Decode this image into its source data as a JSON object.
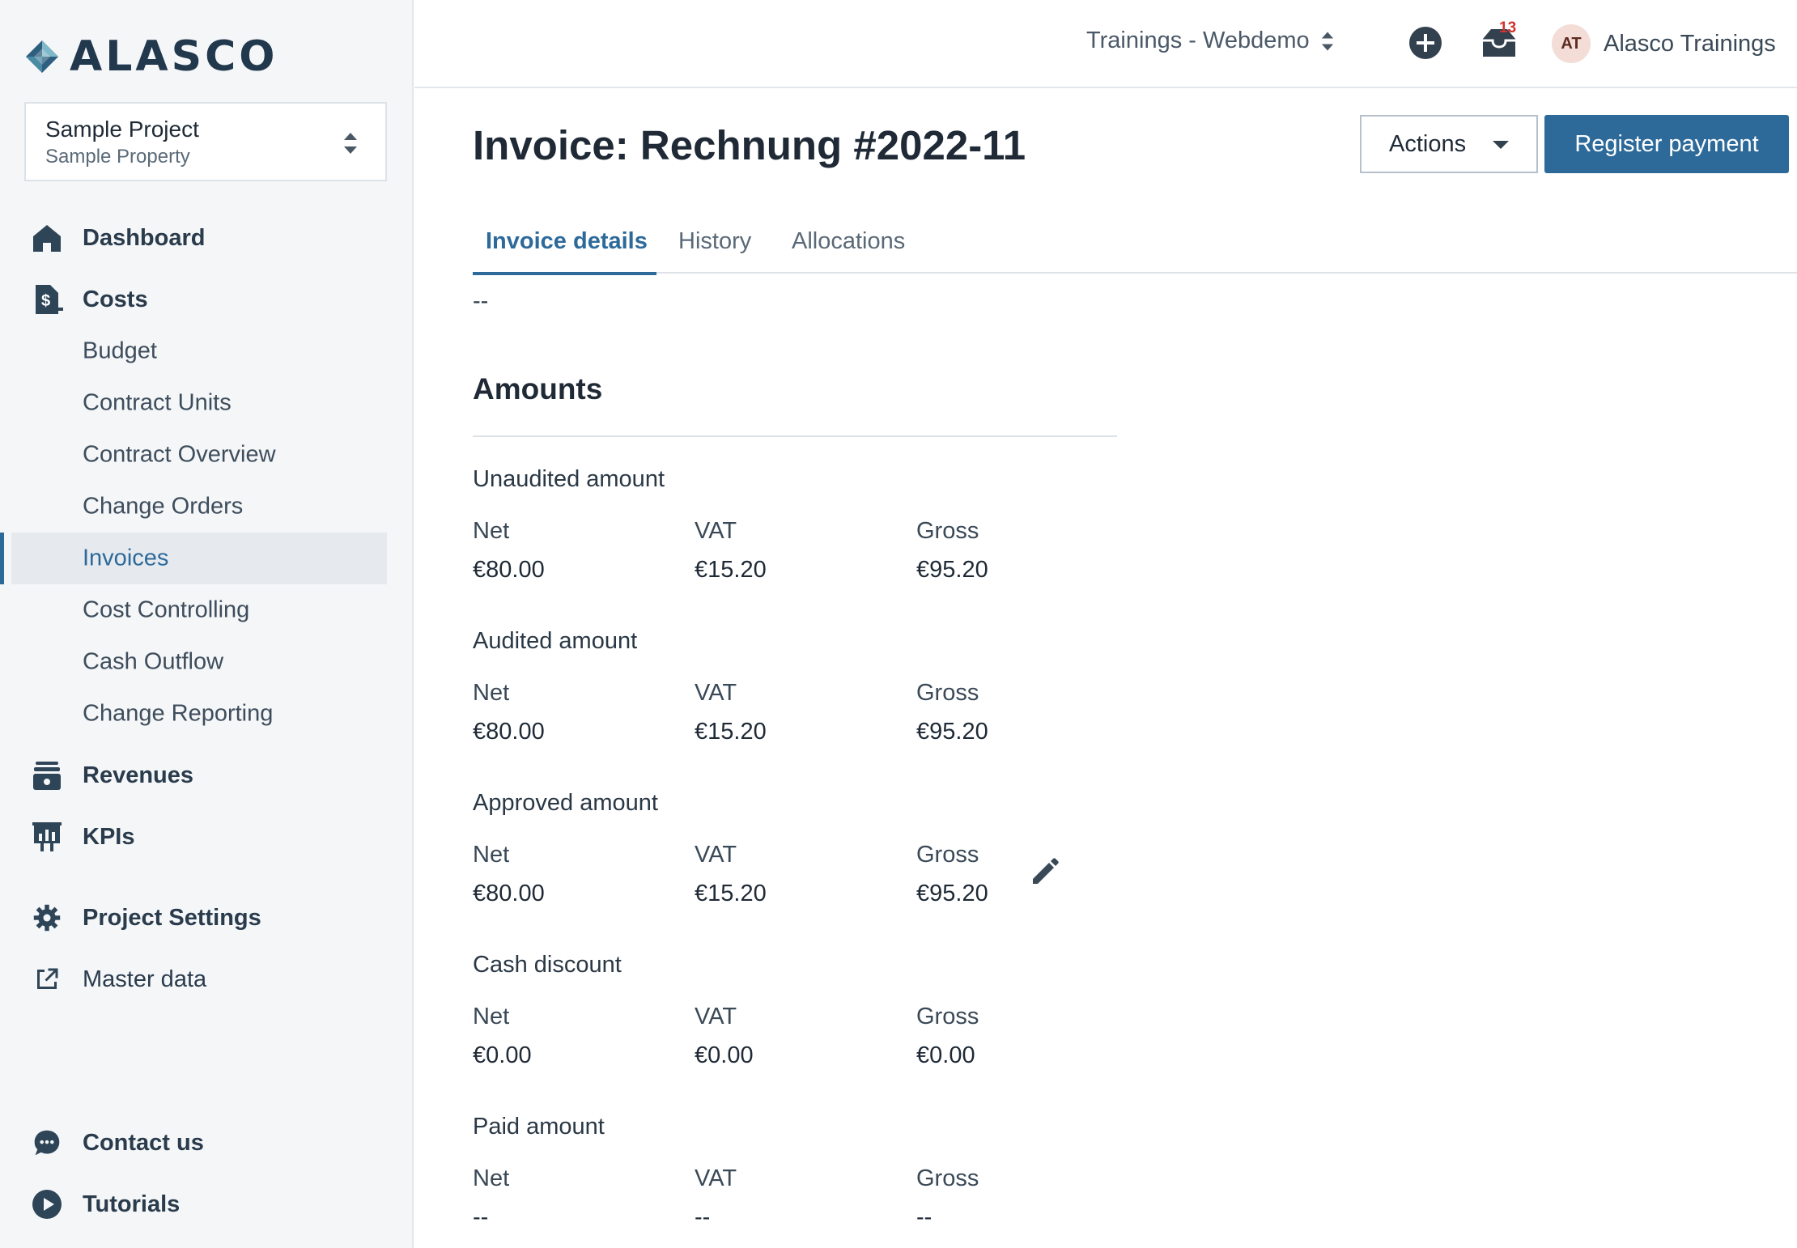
{
  "brand": {
    "name": "ALASCO"
  },
  "project": {
    "name": "Sample Project",
    "property": "Sample Property"
  },
  "nav": {
    "dashboard": "Dashboard",
    "costs": "Costs",
    "costs_items": [
      "Budget",
      "Contract Units",
      "Contract Overview",
      "Change Orders",
      "Invoices",
      "Cost Controlling",
      "Cash Outflow",
      "Change Reporting"
    ],
    "active_item": "Invoices",
    "revenues": "Revenues",
    "kpis": "KPIs",
    "project_settings": "Project Settings",
    "master_data": "Master data",
    "contact_us": "Contact us",
    "tutorials": "Tutorials"
  },
  "header": {
    "workspace": "Trainings - Webdemo",
    "inbox_count": "13",
    "user_initials": "AT",
    "user_name": "Alasco Trainings"
  },
  "page": {
    "title": "Invoice: Rechnung #2022-11",
    "actions_label": "Actions",
    "register_payment_label": "Register payment",
    "tabs": [
      "Invoice details",
      "History",
      "Allocations"
    ],
    "active_tab": "Invoice details",
    "clipped_value": "--"
  },
  "amounts": {
    "section_title": "Amounts",
    "col_labels": {
      "net": "Net",
      "vat": "VAT",
      "gross": "Gross"
    },
    "groups": [
      {
        "title": "Unaudited amount",
        "net": "€80.00",
        "vat": "€15.20",
        "gross": "€95.20"
      },
      {
        "title": "Audited amount",
        "net": "€80.00",
        "vat": "€15.20",
        "gross": "€95.20"
      },
      {
        "title": "Approved amount",
        "net": "€80.00",
        "vat": "€15.20",
        "gross": "€95.20",
        "editable": true
      },
      {
        "title": "Cash discount",
        "net": "€0.00",
        "vat": "€0.00",
        "gross": "€0.00"
      },
      {
        "title": "Paid amount",
        "net": "--",
        "vat": "--",
        "gross": "--"
      }
    ]
  },
  "colors": {
    "accent": "#2d6a9a",
    "sidebar_bg": "#f4f6f8",
    "badge": "#d0342c",
    "text": "#263240"
  },
  "icons": [
    "home-icon",
    "costs-icon",
    "revenues-icon",
    "kpis-icon",
    "gear-icon",
    "external-link-icon",
    "chat-icon",
    "play-icon",
    "plus-circle-icon",
    "inbox-icon",
    "pencil-icon",
    "chevron-updown-icon",
    "caret-down-icon"
  ]
}
